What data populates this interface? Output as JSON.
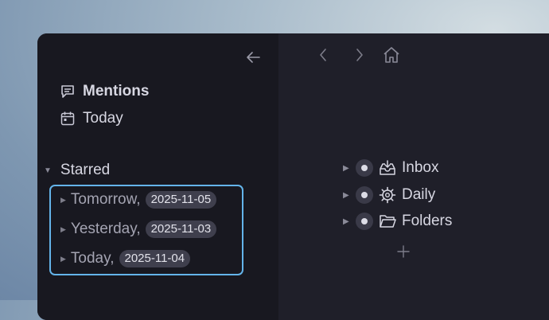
{
  "sidebar": {
    "back_icon": "arrow-left-icon",
    "nav": [
      {
        "label": "Mentions",
        "icon": "message-icon"
      },
      {
        "label": "Today",
        "icon": "calendar-icon"
      }
    ],
    "starred": {
      "title": "Starred",
      "items": [
        {
          "label": "Tomorrow,",
          "date": "2025-11-05"
        },
        {
          "label": "Yesterday,",
          "date": "2025-11-03"
        },
        {
          "label": "Today,",
          "date": "2025-11-04"
        }
      ]
    }
  },
  "toolbar": {
    "icons": [
      "chevron-left-icon",
      "chevron-right-icon",
      "home-icon"
    ]
  },
  "tree": {
    "items": [
      {
        "label": "Inbox",
        "icon": "inbox-icon"
      },
      {
        "label": "Daily",
        "icon": "gear-icon"
      },
      {
        "label": "Folders",
        "icon": "folder-icon"
      }
    ],
    "add_icon": "plus-icon"
  },
  "colors": {
    "accent": "#64b4ea",
    "sidebar_bg": "#181820",
    "main_bg": "#1f1f29"
  }
}
